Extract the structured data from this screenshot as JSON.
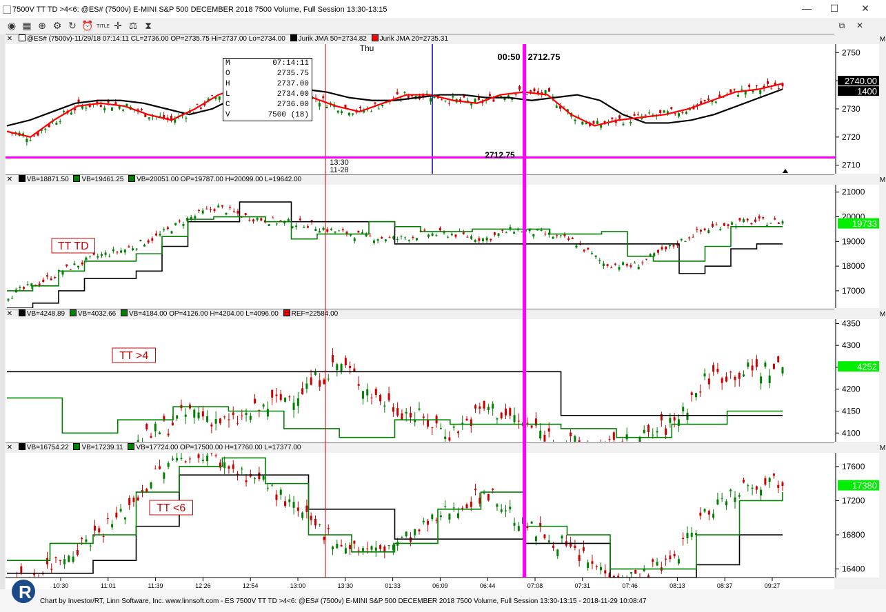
{
  "window": {
    "title": "7500V TT TD >4<6: @ES# (7500v) E-MINI S&P 500 DECEMBER 2018 7500 Volume, Full Session 13:30-13:15",
    "minimize_glyph": "—",
    "maximize_glyph": "☐",
    "close_glyph": "✕",
    "restore_glyph": "⧉"
  },
  "toolbar": {
    "icons": [
      "chart-type-icon",
      "bars-icon",
      "zoom-icon",
      "settings-icon",
      "refresh-icon",
      "alarm-icon",
      "title-icon",
      "crosshair-icon",
      "draw-icon",
      "hourglass-icon"
    ],
    "glyphs": [
      "◉",
      "▦",
      "⊕",
      "⚙",
      "↻",
      "⏰",
      "T",
      "✛",
      "⚖",
      "⧗"
    ],
    "title_icon_label": "TITLE"
  },
  "panels": [
    {
      "id": "price",
      "header": "@ES# (7500v)-11/29/18 07:14:11 CL=2736.00 OP=2735.75 Hi=2737.00 Lo=2734.00",
      "legend": [
        {
          "label": "Jurik JMA 50=2734.82",
          "color": "#000000"
        },
        {
          "label": "Jurik JMA 20=2735.31",
          "color": "#ff0000"
        }
      ],
      "y_ticks": [
        "2750",
        "2740",
        "2730",
        "2720",
        "2710"
      ],
      "last_price": "2740.00",
      "last_sub": "1400",
      "day_label": "Thu",
      "date_label_time": "13:30",
      "date_label_date": "11-28",
      "cursor_time": "00:50",
      "cursor_price": "2712.75",
      "line_price": "2712.75",
      "databox": {
        "M": "07:14:11",
        "O": "2735.75",
        "H": "2737.00",
        "L": "2734.00",
        "C": "2736.00",
        "V": "7500",
        "V_extra": "(18)"
      },
      "databox_keys": [
        "M",
        "O",
        "H",
        "L",
        "C",
        "V"
      ]
    },
    {
      "id": "td",
      "header_items": [
        {
          "label": "VB=18871.50",
          "color": "#000000"
        },
        {
          "label": "VB=19461.25",
          "color": "#008000"
        },
        {
          "label": "VB=20051.00 OP=19787.00 H=20099.00 L=19642.00",
          "color": "#008000"
        }
      ],
      "y_ticks": [
        "21000",
        "20000",
        "19000",
        "18000",
        "17000"
      ],
      "last_value": "19733",
      "label": "TT TD"
    },
    {
      "id": "gt4",
      "header_items": [
        {
          "label": "VB=4248.89",
          "color": "#000000"
        },
        {
          "label": "VB=4032.66",
          "color": "#008000"
        },
        {
          "label": "VB=4184.00 OP=4126.00 H=4204.00 L=4096.00",
          "color": "#008000"
        },
        {
          "label": "REF=22584.00",
          "color": "#cc0000"
        }
      ],
      "y_ticks": [
        "4350",
        "4300",
        "4250",
        "4200",
        "4150",
        "4100"
      ],
      "last_value": "4252",
      "label": "TT >4"
    },
    {
      "id": "lt6",
      "header_items": [
        {
          "label": "VB=16754.22",
          "color": "#000000"
        },
        {
          "label": "VB=17239.11",
          "color": "#008000"
        },
        {
          "label": "VB=17724.00 OP=17500.00 H=17760.00 L=17377.00",
          "color": "#008000"
        }
      ],
      "y_ticks": [
        "17600",
        "17200",
        "16800",
        "16400"
      ],
      "last_value": "17380",
      "label": "TT <6"
    }
  ],
  "x_ticks": [
    "10:30",
    "11:01",
    "11:39",
    "12:26",
    "12:54",
    "13:00",
    "13:30",
    "01:33",
    "06:09",
    "06:44",
    "07:08",
    "07:31",
    "07:46",
    "08:13",
    "08:37",
    "09:27"
  ],
  "footer": "Chart by Investor/RT, Linn Software, Inc. www.linnsoft.com - ES 7500V TT TD >4<6: @ES# (7500v) E-MINI S&P 500 DECEMBER 2018 7500 Volume, Full Session 13:30-13:15 - 2018-11-29 10:08:47",
  "logo_text": "R",
  "colors": {
    "up": "#008000",
    "down": "#cc0000",
    "jma50": "#000000",
    "jma20": "#ff0000",
    "cursor": "#ff00ff",
    "highlight": "#00ee00",
    "session": "#cc0000",
    "vline": "#0000aa"
  },
  "chart_data": [
    {
      "type": "line",
      "title": "@ES# (7500v)",
      "ylim": [
        2707,
        2753
      ],
      "series": [
        {
          "name": "Jurik JMA 50",
          "values": [
            2724,
            2726,
            2729,
            2732,
            2733,
            2733,
            2732,
            2730,
            2728,
            2730,
            2734,
            2737,
            2738,
            2737,
            2736,
            2734,
            2733,
            2733,
            2734,
            2735,
            2735,
            2734,
            2734,
            2733,
            2734,
            2735,
            2733,
            2728,
            2725,
            2725,
            2726,
            2728,
            2731,
            2734,
            2737
          ]
        },
        {
          "name": "Jurik JMA 20",
          "values": [
            2722,
            2720,
            2726,
            2731,
            2732,
            2731,
            2728,
            2726,
            2730,
            2735,
            2738,
            2738,
            2736,
            2734,
            2731,
            2729,
            2732,
            2735,
            2735,
            2733,
            2732,
            2735,
            2736,
            2735,
            2728,
            2724,
            2726,
            2727,
            2728,
            2730,
            2733,
            2736,
            2737,
            2739
          ]
        }
      ]
    },
    {
      "type": "line",
      "title": "TT TD",
      "ylim": [
        16300,
        21300
      ],
      "series": [
        {
          "name": "VB=18871.50",
          "values": [
            16300,
            16500,
            17000,
            17500,
            17500,
            17800,
            18800,
            19800,
            19800,
            20600,
            20600,
            19800,
            19800,
            19800,
            19800,
            18900,
            18900,
            18900,
            18900,
            18900,
            18900,
            18900,
            18900,
            18900,
            18900,
            18900,
            17700,
            18000,
            18700,
            18900,
            18900
          ]
        },
        {
          "name": "VB=19461.25",
          "values": [
            17000,
            17200,
            17800,
            18200,
            18200,
            18500,
            19200,
            19900,
            20000,
            20000,
            19800,
            19100,
            19300,
            19300,
            19800,
            19600,
            19400,
            19400,
            19500,
            19500,
            19500,
            19300,
            19300,
            19400,
            18400,
            18200,
            18200,
            18800,
            19600,
            19600,
            19600
          ]
        }
      ]
    },
    {
      "type": "line",
      "title": "TT >4",
      "ylim": [
        4080,
        4360
      ],
      "series": [
        {
          "name": "VB=4248.89",
          "values": [
            4240,
            4240,
            4240,
            4240,
            4240,
            4240,
            4240,
            4240,
            4240,
            4240,
            4140,
            4140,
            4140,
            4140,
            4140
          ]
        },
        {
          "name": "VB=4032.66",
          "values": [
            4180,
            4100,
            4130,
            4160,
            4150,
            4110,
            4090,
            4130,
            4120,
            4120,
            4110,
            4090,
            4120,
            4150,
            4150
          ]
        }
      ]
    },
    {
      "type": "line",
      "title": "TT <6",
      "ylim": [
        16300,
        17760
      ],
      "series": [
        {
          "name": "VB=16754.22",
          "values": [
            16350,
            16350,
            16500,
            16900,
            17500,
            17500,
            17500,
            17100,
            17100,
            16750,
            16750,
            16750,
            16700,
            16700,
            16300,
            16300,
            16450,
            16800,
            16800
          ]
        },
        {
          "name": "VB=17239.11",
          "values": [
            16500,
            16700,
            16800,
            17300,
            17600,
            17700,
            17400,
            16800,
            16600,
            16700,
            17100,
            17300,
            16900,
            16800,
            16400,
            16400,
            16800,
            17200,
            17300
          ]
        }
      ]
    }
  ]
}
